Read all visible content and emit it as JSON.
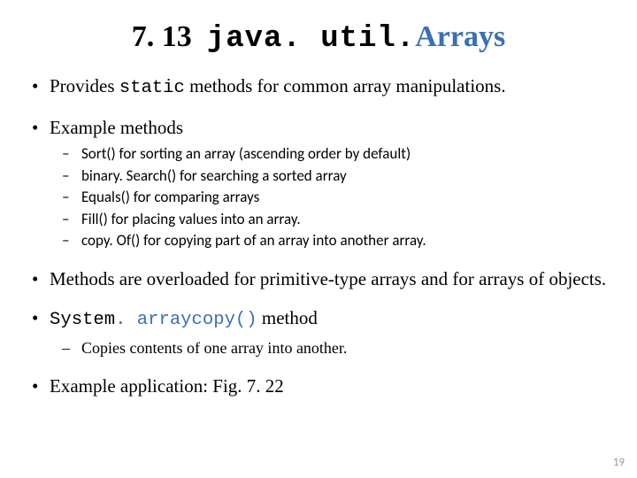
{
  "title": {
    "prefix": "7. 13  ",
    "java": "java. util.",
    "arrays": "Arrays"
  },
  "b1": {
    "pre": "Provides ",
    "code": "static",
    "post": " methods for common array manipulations."
  },
  "b2": {
    "text": "Example methods",
    "subs": {
      "s0": "Sort() for sorting an array (ascending order by default)",
      "s1": "binary. Search() for searching a sorted array",
      "s2": "Equals() for comparing arrays",
      "s3": "Fill() for placing values into an array.",
      "s4": "copy. Of() for copying part of an array into another array."
    }
  },
  "b3": "Methods are overloaded for primitive-type arrays and for arrays of objects.",
  "b4": {
    "code_pre": "System",
    "code_blue": ". arraycopy()",
    "post": " method",
    "sub": "Copies contents of one array into another."
  },
  "b5": "Example application: Fig. 7. 22",
  "pagenum": "19"
}
